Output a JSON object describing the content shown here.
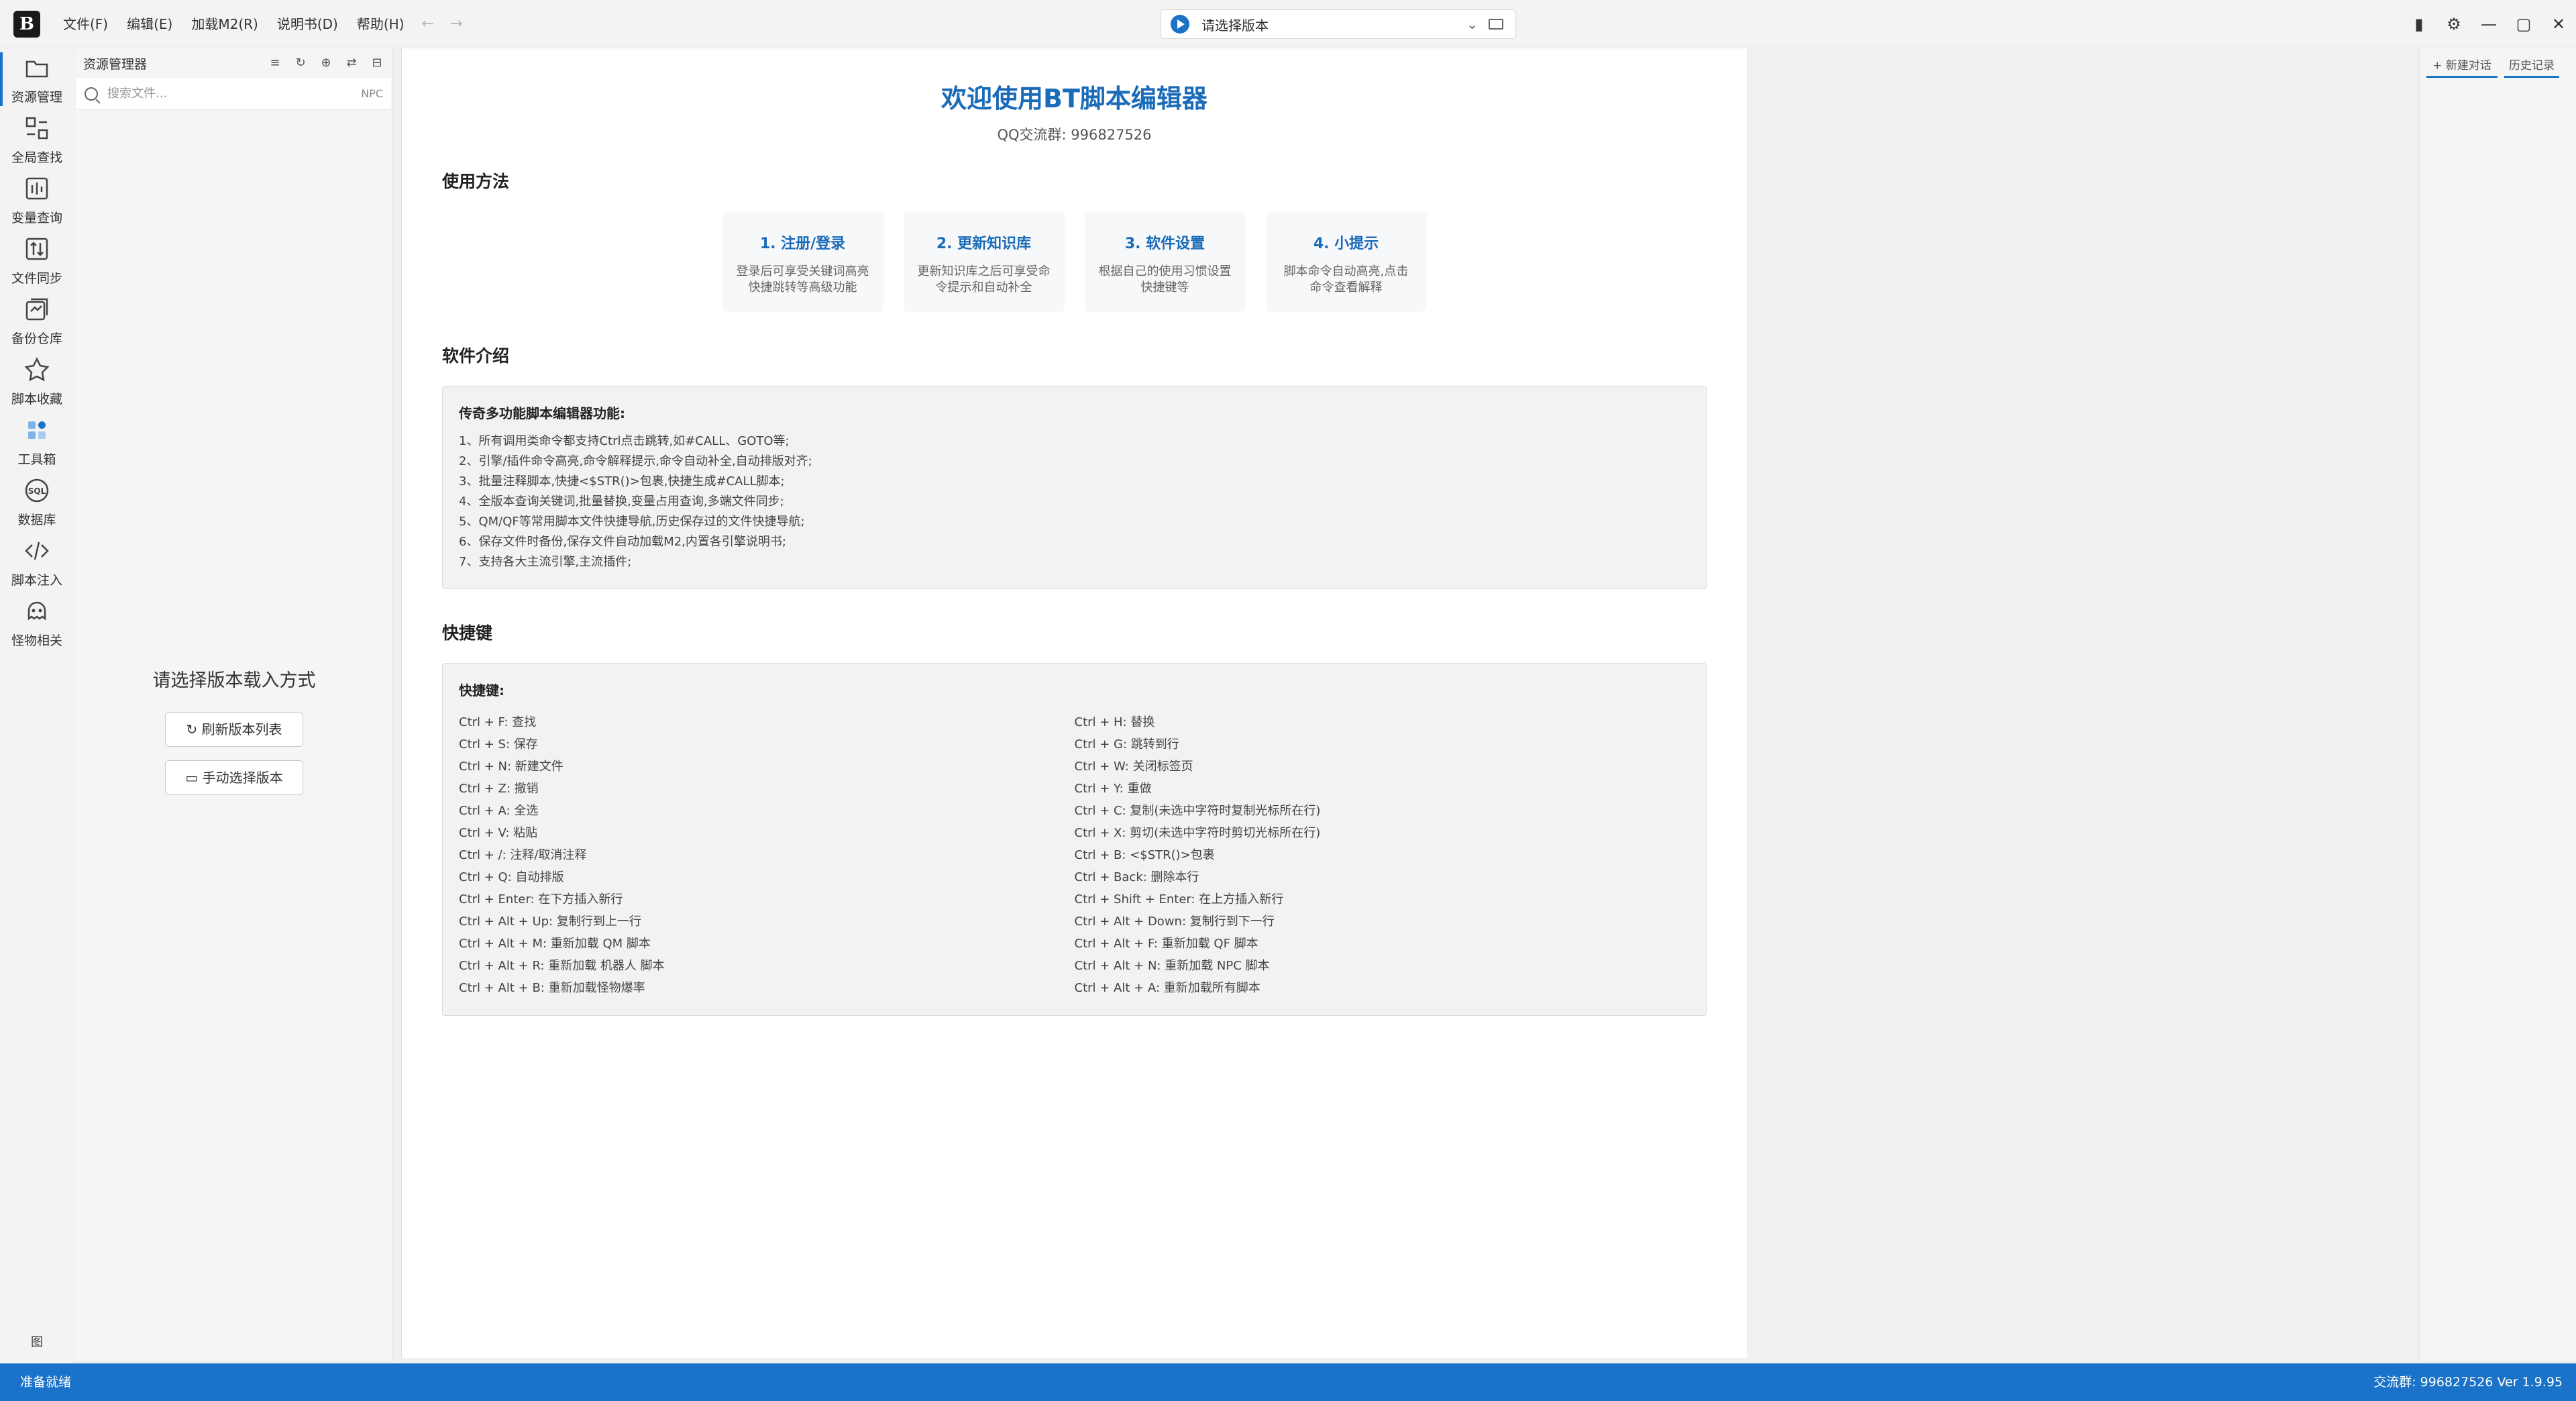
{
  "app": {
    "logo_text": "B"
  },
  "menu": [
    "文件(F)",
    "编辑(E)",
    "加载M2(R)",
    "说明书(D)",
    "帮助(H)"
  ],
  "nav": {
    "back": "←",
    "forward": "→"
  },
  "version_select": {
    "label": "请选择版本"
  },
  "window_controls": {
    "layout": "▮",
    "settings": "⚙",
    "minimize": "—",
    "maximize": "▢",
    "close": "✕"
  },
  "activity": [
    {
      "label": "资源管理",
      "icon": "folder-icon"
    },
    {
      "label": "全局查找",
      "icon": "global-search-icon"
    },
    {
      "label": "变量查询",
      "icon": "variable-query-icon"
    },
    {
      "label": "文件同步",
      "icon": "file-sync-icon"
    },
    {
      "label": "备份仓库",
      "icon": "backup-repo-icon"
    },
    {
      "label": "脚本收藏",
      "icon": "star-icon"
    },
    {
      "label": "工具箱",
      "icon": "toolbox-icon"
    },
    {
      "label": "数据库",
      "icon": "sql-database-icon"
    },
    {
      "label": "脚本注入",
      "icon": "code-icon"
    },
    {
      "label": "怪物相关",
      "icon": "monster-icon"
    }
  ],
  "activity_bottom": "图",
  "explorer": {
    "title": "资源管理器",
    "search_placeholder": "搜索文件...",
    "search_mode": "NPC",
    "prompt": "请选择版本载入方式",
    "refresh_button": "刷新版本列表",
    "manual_button": "手动选择版本"
  },
  "main": {
    "title": "欢迎使用BT脚本编辑器",
    "qq": "QQ交流群: 996827526",
    "howto_title": "使用方法",
    "steps": [
      {
        "title": "1. 注册/登录",
        "desc": "登录后可享受关键词高亮快捷跳转等高级功能"
      },
      {
        "title": "2. 更新知识库",
        "desc": "更新知识库之后可享受命令提示和自动补全"
      },
      {
        "title": "3. 软件设置",
        "desc": "根据自己的使用习惯设置快捷键等"
      },
      {
        "title": "4. 小提示",
        "desc": "脚本命令自动高亮,点击命令查看解释"
      }
    ],
    "intro_title": "软件介绍",
    "intro_box_title": "传奇多功能脚本编辑器功能:",
    "intro_lines": [
      "1、所有调用类命令都支持Ctrl点击跳转,如#CALL、GOTO等;",
      "2、引擎/插件命令高亮,命令解释提示,命令自动补全,自动排版对齐;",
      "3、批量注释脚本,快捷<$STR()>包裹,快捷生成#CALL脚本;",
      "4、全版本查询关键词,批量替换,变量占用查询,多端文件同步;",
      "5、QM/QF等常用脚本文件快捷导航,历史保存过的文件快捷导航;",
      "6、保存文件时备份,保存文件自动加载M2,内置各引擎说明书;",
      "7、支持各大主流引擎,主流插件;"
    ],
    "shortcut_title": "快捷键",
    "shortcut_box_title": "快捷键:",
    "shortcuts_left": [
      "Ctrl + F: 查找",
      "Ctrl + S: 保存",
      "Ctrl + N: 新建文件",
      "Ctrl + Z: 撤销",
      "Ctrl + A: 全选",
      "Ctrl + V: 粘贴",
      "Ctrl + /: 注释/取消注释",
      "Ctrl + Q: 自动排版",
      "Ctrl + Enter: 在下方插入新行",
      "Ctrl + Alt + Up: 复制行到上一行",
      "Ctrl + Alt + M: 重新加载 QM 脚本",
      "Ctrl + Alt + R: 重新加载 机器人 脚本",
      "Ctrl + Alt + B: 重新加载怪物爆率"
    ],
    "shortcuts_right": [
      "Ctrl + H: 替换",
      "Ctrl + G: 跳转到行",
      "Ctrl + W: 关闭标签页",
      "Ctrl + Y: 重做",
      "Ctrl + C: 复制(未选中字符时复制光标所在行)",
      "Ctrl + X: 剪切(未选中字符时剪切光标所在行)",
      "Ctrl + B: <$STR()>包裹",
      "Ctrl + Back: 删除本行",
      "Ctrl + Shift + Enter: 在上方插入新行",
      "Ctrl + Alt + Down: 复制行到下一行",
      "Ctrl + Alt + F: 重新加载 QF 脚本",
      "Ctrl + Alt + N: 重新加载 NPC 脚本",
      "Ctrl + Alt + A: 重新加载所有脚本"
    ]
  },
  "right_panel": {
    "new_chat": "+ 新建对话",
    "history": "历史记录"
  },
  "status": {
    "left": "准备就绪",
    "right": "交流群: 996827526   Ver 1.9.95"
  },
  "colors": {
    "accent": "#1a73c8",
    "title_blue": "#1a6bb8",
    "status_bar": "#1a73c8"
  }
}
